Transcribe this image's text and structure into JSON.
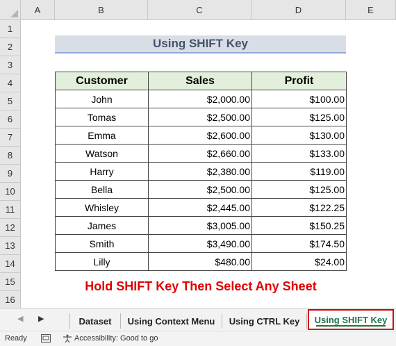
{
  "columns": [
    "A",
    "B",
    "C",
    "D",
    "E"
  ],
  "rows": [
    "1",
    "2",
    "3",
    "4",
    "5",
    "6",
    "7",
    "8",
    "9",
    "10",
    "11",
    "12",
    "13",
    "14",
    "15",
    "16"
  ],
  "sheet": {
    "title": "Using SHIFT Key",
    "headers": [
      "Customer",
      "Sales",
      "Profit"
    ],
    "records": [
      {
        "customer": "John",
        "sales": "$2,000.00",
        "profit": "$100.00"
      },
      {
        "customer": "Tomas",
        "sales": "$2,500.00",
        "profit": "$125.00"
      },
      {
        "customer": "Emma",
        "sales": "$2,600.00",
        "profit": "$130.00"
      },
      {
        "customer": "Watson",
        "sales": "$2,660.00",
        "profit": "$133.00"
      },
      {
        "customer": "Harry",
        "sales": "$2,380.00",
        "profit": "$119.00"
      },
      {
        "customer": "Bella",
        "sales": "$2,500.00",
        "profit": "$125.00"
      },
      {
        "customer": "Whisley",
        "sales": "$2,445.00",
        "profit": "$122.25"
      },
      {
        "customer": "James",
        "sales": "$3,005.00",
        "profit": "$150.25"
      },
      {
        "customer": "Smith",
        "sales": "$3,490.00",
        "profit": "$174.50"
      },
      {
        "customer": "Lilly",
        "sales": "$480.00",
        "profit": "$24.00"
      }
    ],
    "note": "Hold SHIFT Key Then Select Any Sheet"
  },
  "tabs": [
    {
      "label": "Dataset",
      "active": false
    },
    {
      "label": "Using Context Menu",
      "active": false
    },
    {
      "label": "Using CTRL Key",
      "active": false
    },
    {
      "label": "Using SHIFT Key",
      "active": true
    }
  ],
  "tab_nav": {
    "prev": "◀",
    "next": "▶"
  },
  "status": {
    "ready": "Ready",
    "accessibility": "Accessibility: Good to go"
  },
  "colors": {
    "active_tab": "#217346",
    "highlight": "#d10000",
    "header_fill": "#e2efda",
    "title_fill": "#d9dde6",
    "note_text": "#e00000"
  }
}
